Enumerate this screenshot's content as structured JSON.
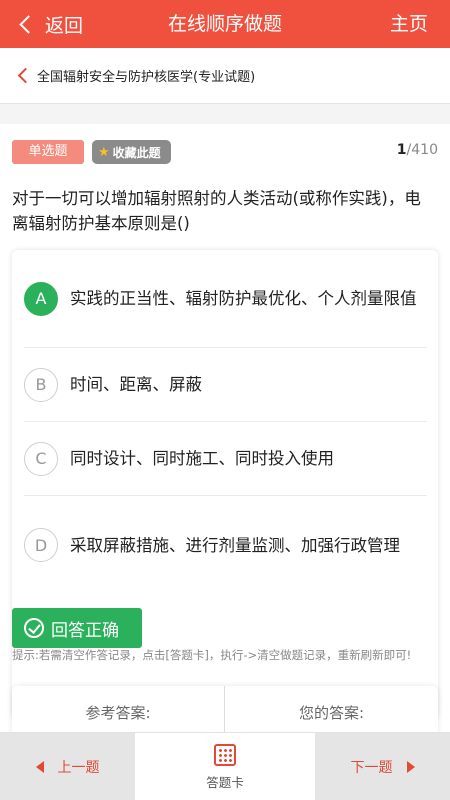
{
  "header": {
    "back_label": "返回",
    "title": "在线顺序做题",
    "home_label": "主页",
    "color": "#f0513e"
  },
  "subject": {
    "name": "全国辐射安全与防护核医学(专业试题)"
  },
  "question": {
    "type_label": "单选题",
    "favorite_label": "收藏此题",
    "current": "1",
    "total": "/410",
    "text": "对于一切可以增加辐射照射的人类活动(或称作实践)，电离辐射防护基本原则是()",
    "options": [
      {
        "letter": "A",
        "text": "实践的正当性、辐射防护最优化、个人剂量限值",
        "state": "correct"
      },
      {
        "letter": "B",
        "text": "时间、距离、屏蔽",
        "state": "normal"
      },
      {
        "letter": "C",
        "text": "同时设计、同时施工、同时投入使用",
        "state": "normal"
      },
      {
        "letter": "D",
        "text": "采取屏蔽措施、进行剂量监测、加强行政管理",
        "state": "normal"
      }
    ]
  },
  "result": {
    "label": "回答正确",
    "color": "#2bb15c"
  },
  "hint": "提示:若需清空作答记录，点击[答题卡]，执行->清空做题记录，重新刷新即可!",
  "answers": {
    "reference_label": "参考答案:",
    "yours_label": "您的答案:"
  },
  "bottom": {
    "prev_label": "上一题",
    "card_label": "答题卡",
    "next_label": "下一题"
  }
}
